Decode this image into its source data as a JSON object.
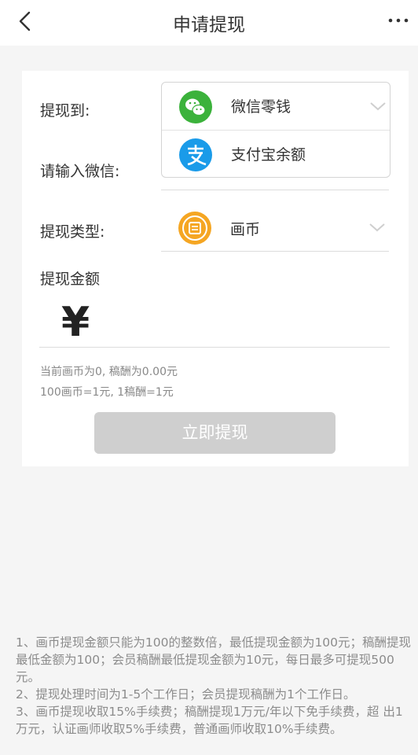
{
  "header": {
    "title": "申请提现"
  },
  "form": {
    "withdraw_to_label": "提现到:",
    "wechat_label": "请输入微信:",
    "options": [
      {
        "name": "微信零钱",
        "icon": "wechat-icon",
        "color": "#3bb23b"
      },
      {
        "name": "支付宝余额",
        "icon": "alipay-icon",
        "color": "#1a9be9"
      }
    ],
    "type_label": "提现类型:",
    "type_value": "画币",
    "type_icon_color": "#f5a623",
    "amount_label": "提现金额",
    "currency_symbol": "¥",
    "balance_line": "当前画币为0, 稿酬为0.00元",
    "rate_line": "100画币=1元, 1稿酬=1元",
    "submit_label": "立即提现"
  },
  "notes": [
    "1、画币提现金额只能为100的整数倍，最低提现金额为100元；稿酬提现最低金额为100；会员稿酬最低提现金额为10元，每日最多可提现500元。",
    " 2、提现处理时间为1-5个工作日；会员提现稿酬为1个工作日。",
    " 3、画币提现收取15%手续费；稿酬提现1万元/年以下免手续费，超 出1万元，认证画师收取5%手续费，普通画师收取10%手续费。"
  ]
}
